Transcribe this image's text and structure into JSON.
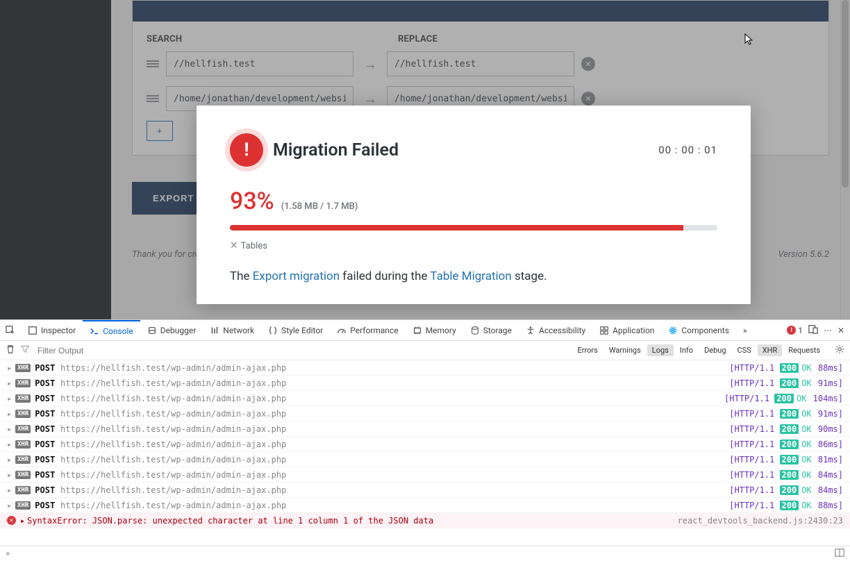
{
  "searchReplace": {
    "searchLabel": "SEARCH",
    "replaceLabel": "REPLACE",
    "rows": [
      {
        "search": "//hellfish.test",
        "replace": "//hellfish.test"
      },
      {
        "search": "/home/jonathan/development/website",
        "replace": "/home/jonathan/development/website"
      }
    ],
    "addLabel": "+"
  },
  "exportLabel": "EXPORT",
  "footer": {
    "thanks": "Thank you for cre",
    "version": "Version 5.6.2"
  },
  "modal": {
    "title": "Migration Failed",
    "timer": "00 : 00 : 01",
    "percent": "93%",
    "bytes": "(1.58 MB / 1.7 MB)",
    "barPct": 93,
    "stage": "Tables",
    "msg_pre": "The ",
    "msg_link1": "Export migration",
    "msg_mid": " failed during the ",
    "msg_link2": "Table Migration",
    "msg_post": " stage."
  },
  "devtools": {
    "tabs": [
      "Inspector",
      "Console",
      "Debugger",
      "Network",
      "Style Editor",
      "Performance",
      "Memory",
      "Storage",
      "Accessibility",
      "Application",
      "Components"
    ],
    "activeTab": "Console",
    "errCount": "1",
    "filterPlaceholder": "Filter Output",
    "chips": [
      "Errors",
      "Warnings",
      "Logs",
      "Info",
      "Debug",
      "CSS",
      "XHR",
      "Requests"
    ],
    "chipsOn": [
      "Logs",
      "XHR"
    ],
    "log": {
      "url": "https://hellfish.test/wp-admin/admin-ajax.php",
      "method": "POST",
      "rows": [
        {
          "ms": "88ms"
        },
        {
          "ms": "91ms"
        },
        {
          "ms": "104ms"
        },
        {
          "ms": "91ms"
        },
        {
          "ms": "90ms"
        },
        {
          "ms": "86ms"
        },
        {
          "ms": "81ms"
        },
        {
          "ms": "84ms"
        },
        {
          "ms": "84ms"
        },
        {
          "ms": "88ms"
        }
      ],
      "httpver": "HTTP/1.1",
      "status": "200",
      "statusText": "OK",
      "error": "SyntaxError: JSON.parse: unexpected character at line 1 column 1 of the JSON data",
      "errorSrc": "react_devtools_backend.js:2430:23"
    }
  }
}
